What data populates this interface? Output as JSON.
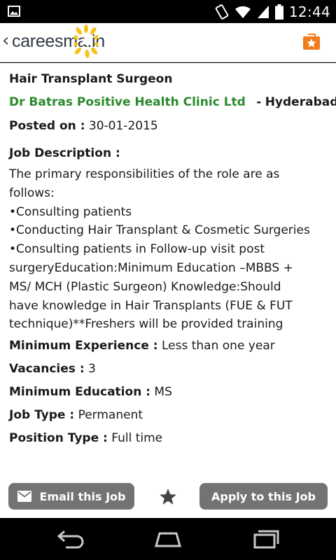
{
  "status_bar": {
    "time": "12:44"
  },
  "app_bar": {
    "brand_name": "careesma",
    "brand_suffix": ".in"
  },
  "job": {
    "title": "Hair Transplant Surgeon",
    "company": "Dr Batras Positive Health Clinic Ltd",
    "location_sep": "-",
    "location": "Hyderabad",
    "posted_label": "Posted on :",
    "posted_value": "30-01-2015",
    "description_label": "Job Description :",
    "description_lines": [
      "The primary responsibilities of the role are as",
      "follows:",
      "•Consulting patients",
      "•Conducting Hair Transplant & Cosmetic Surgeries",
      "•Consulting patients in Follow-up visit post",
      "surgeryEducation:Minimum Education –MBBS +",
      "MS/ MCH (Plastic Surgeon) Knowledge:Should",
      "have knowledge in Hair Transplants (FUE & FUT",
      "technique)**Freshers will be provided training"
    ],
    "details": [
      {
        "label": "Minimum Experience :",
        "value": "Less than one year"
      },
      {
        "label": "Vacancies :",
        "value": "3"
      },
      {
        "label": "Minimum Education :",
        "value": "MS"
      },
      {
        "label": "Job Type :",
        "value": "Permanent"
      },
      {
        "label": "Position Type :",
        "value": "Full time"
      }
    ]
  },
  "actions": {
    "email_label": "Email this Job",
    "apply_label": "Apply to this Job"
  },
  "colors": {
    "company_green": "#2b8a2b",
    "button_gray": "#737373",
    "accent_orange": "#f07c1e",
    "logo_yellow": "#f3c21b"
  },
  "icons": {
    "status_left": "image-icon",
    "status_right": [
      "vibrate-icon",
      "wifi-icon",
      "signal-icon",
      "battery-icon"
    ],
    "app_bar": [
      "back-chevron-icon",
      "sun-logo-icon",
      "favorites-star-bag-icon"
    ],
    "actions": [
      "mail-icon",
      "star-icon"
    ],
    "nav": [
      "back-icon",
      "home-icon",
      "recents-icon"
    ]
  }
}
